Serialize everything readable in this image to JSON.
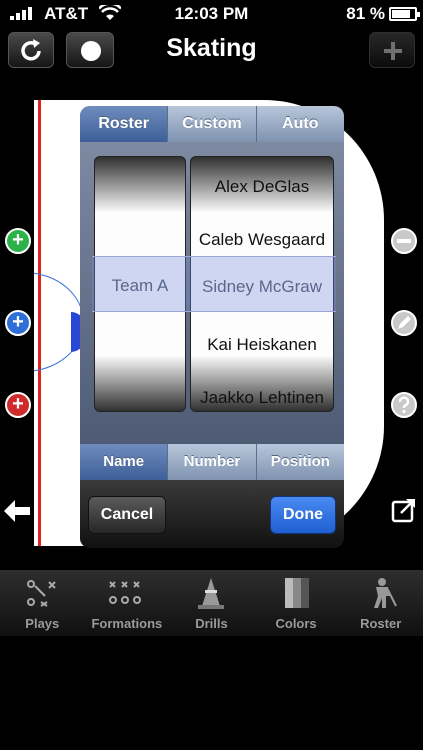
{
  "status_bar": {
    "carrier": "AT&T",
    "time": "12:03 PM",
    "battery_percent": "81 %",
    "battery_level": 0.81
  },
  "nav": {
    "title": "Skating",
    "left_buttons": [
      "refresh-icon",
      "record-dot-icon"
    ],
    "right_button": "plus-icon"
  },
  "picker": {
    "top_segments": [
      {
        "label": "Roster",
        "selected": true
      },
      {
        "label": "Custom",
        "selected": false
      },
      {
        "label": "Auto",
        "selected": false
      }
    ],
    "team_column": [
      "",
      "Team A",
      ""
    ],
    "team_selected": "Team A",
    "name_column": [
      "Alex DeGlas",
      "Caleb Wesgaard",
      "Sidney McGraw",
      "Kai Heiskanen",
      "Jaakko Lehtinen"
    ],
    "name_selected": "Sidney McGraw",
    "bottom_segments": [
      {
        "label": "Name",
        "selected": true
      },
      {
        "label": "Number",
        "selected": false
      },
      {
        "label": "Position",
        "selected": false
      }
    ],
    "cancel_label": "Cancel",
    "done_label": "Done"
  },
  "tabs": [
    {
      "label": "Plays",
      "icon": "plays-icon"
    },
    {
      "label": "Formations",
      "icon": "formations-icon"
    },
    {
      "label": "Drills",
      "icon": "cone-icon"
    },
    {
      "label": "Colors",
      "icon": "colors-icon"
    },
    {
      "label": "Roster",
      "icon": "player-icon"
    }
  ]
}
